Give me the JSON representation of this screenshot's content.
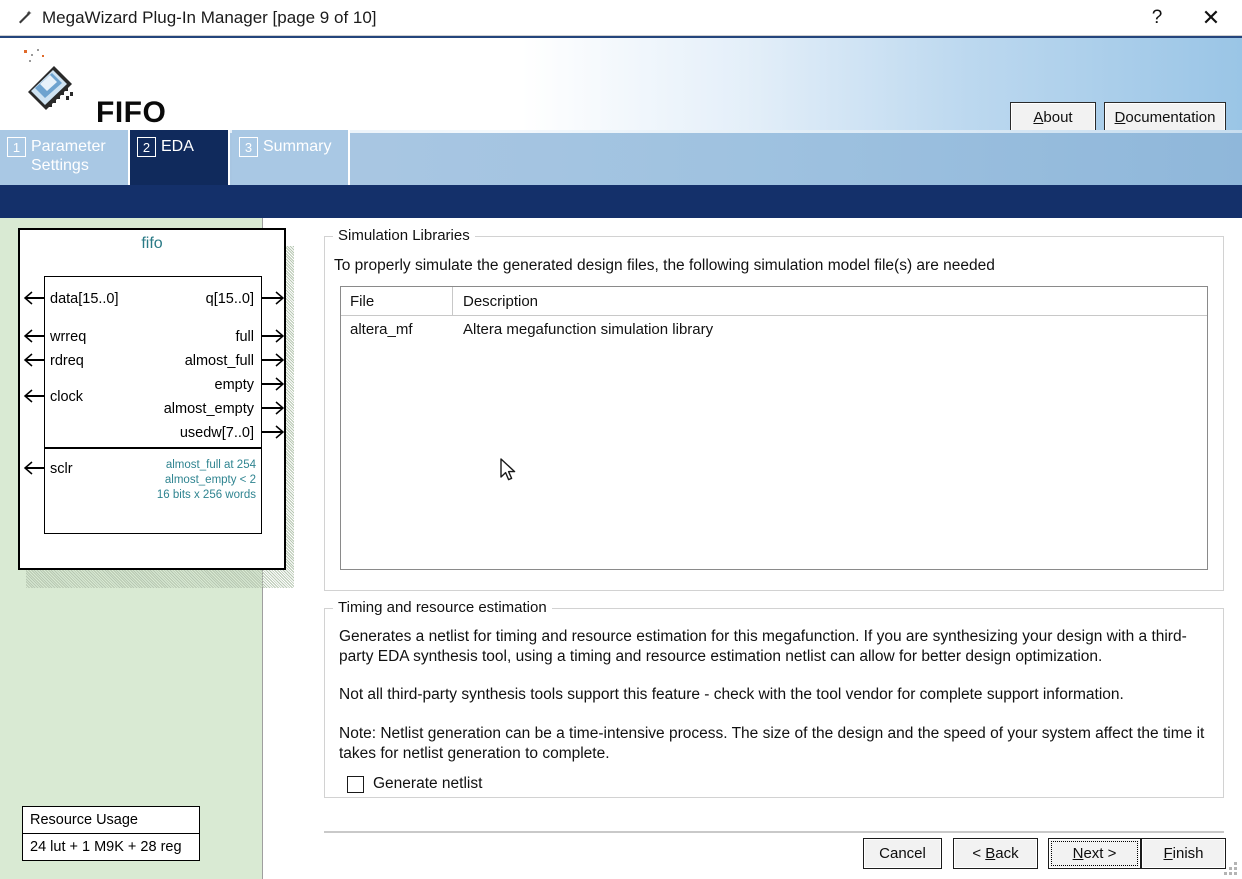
{
  "window": {
    "title": "MegaWizard Plug-In Manager [page 9 of 10]",
    "app_icon": "wizard-wand-icon",
    "help_glyph": "?",
    "close_glyph": "✕"
  },
  "banner": {
    "product": "FIFO",
    "logo": "altera-megafunction-logo",
    "about_label": "About",
    "about_accel": "A",
    "documentation_label": "Documentation",
    "documentation_accel": "D"
  },
  "tabs": [
    {
      "num": "1",
      "label": "Parameter Settings",
      "active": false
    },
    {
      "num": "2",
      "label": "EDA",
      "active": true
    },
    {
      "num": "3",
      "label": "Summary",
      "active": false
    }
  ],
  "preview": {
    "block_title": "fifo",
    "inputs": [
      "data[15..0]",
      "wrreq",
      "rdreq",
      "clock"
    ],
    "input_async": "sclr",
    "outputs": [
      "q[15..0]",
      "full",
      "almost_full",
      "empty",
      "almost_empty",
      "usedw[7..0]"
    ],
    "notes": [
      "almost_full at 254",
      "almost_empty < 2",
      "16 bits x 256 words"
    ],
    "resource": {
      "header": "Resource Usage",
      "value": "24 lut + 1 M9K + 28 reg"
    }
  },
  "sim": {
    "group_title": "Simulation Libraries",
    "description": "To properly simulate the generated design files, the following simulation model file(s) are needed",
    "columns": [
      "File",
      "Description"
    ],
    "rows": [
      {
        "file": "altera_mf",
        "description": "Altera megafunction simulation library"
      }
    ]
  },
  "timing": {
    "group_title": "Timing and resource estimation",
    "para1": "Generates a netlist for timing and resource estimation for this megafunction. If you are synthesizing your design with a third-party EDA synthesis tool, using a timing and resource estimation netlist can allow for better design optimization.",
    "para2": "Not all third-party synthesis tools support this feature - check with the tool vendor for complete support information.",
    "para3": "Note: Netlist generation can be a time-intensive process. The size of the design and the speed of your system affect the time it takes for netlist generation to complete.",
    "checkbox_label": "Generate netlist",
    "checkbox_checked": false
  },
  "footer": {
    "cancel_label": "Cancel",
    "back_label": "< Back",
    "back_accel": "B",
    "next_label": "Next >",
    "next_accel": "N",
    "finish_label": "Finish",
    "finish_accel": "F",
    "focused_button": "Next >"
  },
  "colors": {
    "accent_navy": "#14306a",
    "tab_blue": "#a9c8e4",
    "preview_green": "#d9ead3",
    "note_teal": "#2f8490"
  }
}
